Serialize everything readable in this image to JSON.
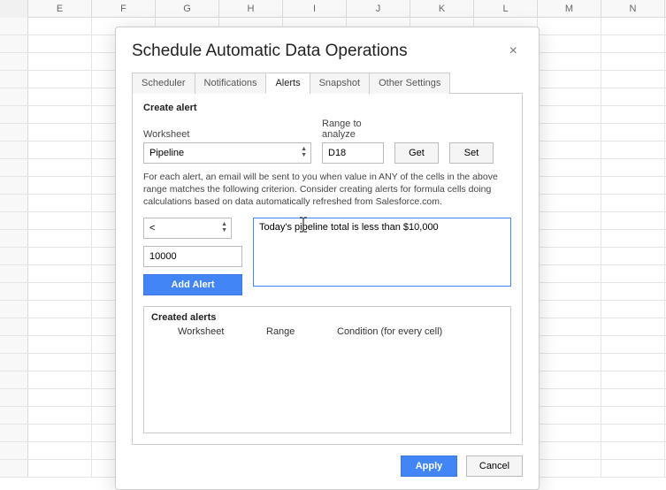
{
  "spreadsheet": {
    "columns": [
      "",
      "E",
      "F",
      "G",
      "H",
      "I",
      "J",
      "K",
      "L",
      "M",
      "N"
    ]
  },
  "dialog": {
    "title": "Schedule Automatic Data Operations",
    "close_label": "×",
    "tabs": {
      "scheduler": "Scheduler",
      "notifications": "Notifications",
      "alerts": "Alerts",
      "snapshot": "Snapshot",
      "other": "Other Settings"
    },
    "alerts_panel": {
      "section_title": "Create alert",
      "worksheet_label": "Worksheet",
      "worksheet_value": "Pipeline",
      "range_label": "Range to analyze",
      "range_value": "D18",
      "get_label": "Get",
      "set_label": "Set",
      "help_text": "For each alert, an email will be sent to you when value in ANY of the cells in the above range matches the following criterion. Consider creating alerts for formula cells doing calculations based on data automatically refreshed from Salesforce.com.",
      "operator_value": "<",
      "threshold_value": "10000",
      "message_value": "Today's pipeline total is less than $10,000",
      "add_alert_label": "Add Alert",
      "created_title": "Created alerts",
      "created_headers": {
        "worksheet": "Worksheet",
        "range": "Range",
        "condition": "Condition (for every cell)"
      }
    },
    "footer": {
      "apply": "Apply",
      "cancel": "Cancel"
    }
  }
}
